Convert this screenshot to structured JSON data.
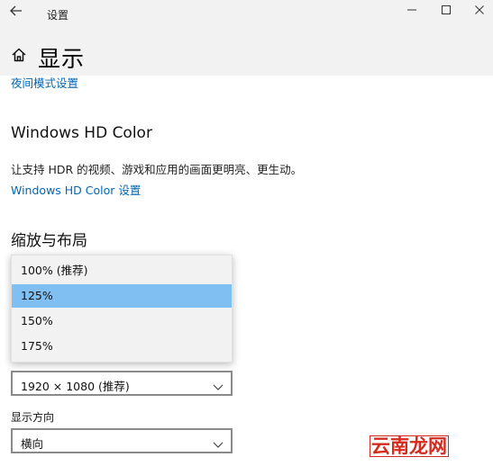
{
  "window": {
    "back_icon": "back-arrow-icon",
    "title": "设置",
    "minimize_icon": "minimize-icon",
    "maximize_icon": "maximize-icon",
    "close_icon": "close-icon"
  },
  "header": {
    "home_icon": "home-icon",
    "page_title": "显示"
  },
  "night_light_link": "夜间模式设置",
  "hd_color": {
    "title": "Windows HD Color",
    "description": "让支持 HDR 的视频、游戏和应用的画面更明亮、更生动。",
    "link": "Windows HD Color 设置"
  },
  "scale_layout": {
    "title": "缩放与布局",
    "scale_options": [
      "100% (推荐)",
      "125%",
      "150%",
      "175%"
    ],
    "selected_index": 1,
    "resolution_value": "1920 × 1080 (推荐)",
    "orientation_label": "显示方向",
    "orientation_value": "横向"
  },
  "watermark": "云南龙网",
  "colors": {
    "link": "#0066b4",
    "selection": "#7fbff1",
    "watermark": "#d42a1e"
  }
}
